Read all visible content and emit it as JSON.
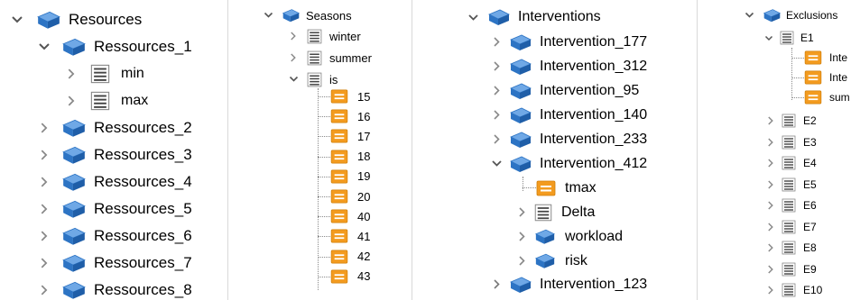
{
  "colors": {
    "cube": "#2d74c4",
    "orange": "#f39b1f",
    "list_icon": "#444444",
    "chevron": "#666666"
  },
  "icons": {
    "expanded": "chevron-down-icon",
    "collapsed": "chevron-right-icon",
    "object": "cube-icon",
    "array": "list-icon",
    "value": "value-icon"
  },
  "panels": {
    "resources": {
      "root": "Resources",
      "child": "Ressources_1",
      "child_items": [
        "min",
        "max"
      ],
      "siblings": [
        "Ressources_2",
        "Ressources_3",
        "Ressources_4",
        "Ressources_5",
        "Ressources_6",
        "Ressources_7",
        "Ressources_8"
      ]
    },
    "seasons": {
      "root": "Seasons",
      "items": [
        "winter",
        "summer",
        "is"
      ],
      "is_values": [
        "15",
        "16",
        "17",
        "18",
        "19",
        "20",
        "40",
        "41",
        "42",
        "43"
      ]
    },
    "interventions": {
      "root": "Interventions",
      "items": [
        "Intervention_177",
        "Intervention_312",
        "Intervention_95",
        "Intervention_140",
        "Intervention_233",
        "Intervention_412"
      ],
      "expanded_children": [
        "tmax",
        "Delta",
        "workload",
        "risk"
      ],
      "last": "Intervention_123"
    },
    "exclusions": {
      "root": "Exclusions",
      "e1": "E1",
      "e1_children": [
        "Inte",
        "Inte",
        "sum"
      ],
      "others": [
        "E2",
        "E3",
        "E4",
        "E5",
        "E6",
        "E7",
        "E8",
        "E9",
        "E10"
      ]
    }
  }
}
